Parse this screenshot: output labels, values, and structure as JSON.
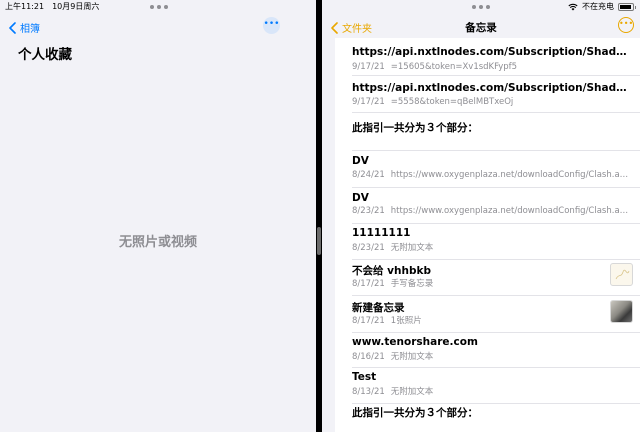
{
  "status": {
    "time": "上午11:21",
    "date": "10月9日周六",
    "charging": "不在充电",
    "battery_level": 0.9
  },
  "left_pane": {
    "back_label": "相簿",
    "more_label": "•••",
    "album_title": "个人收藏",
    "empty_message": "无照片或视频"
  },
  "right_pane": {
    "back_label": "文件夹",
    "title": "备忘录",
    "more_label": "•••",
    "notes": [
      {
        "title": "https://api.nxtlnodes.com/Subscription/ShadowRocket...",
        "date": "9/17/21",
        "preview": "=15605&token=Xv1sdKFypf5"
      },
      {
        "title": "https://api.nxtlnodes.com/Subscription/ShadowRocket...",
        "date": "9/17/21",
        "preview": "=5558&token=qBelMBTxeOj"
      },
      {
        "title": "此指引一共分为３个部分：",
        "date": "",
        "preview": ""
      },
      {
        "title": "DV",
        "date": "8/24/21",
        "preview": "https://www.oxygenplaza.net/downloadConfig/Clash.as..."
      },
      {
        "title": "DV",
        "date": "8/23/21",
        "preview": "https://www.oxygenplaza.net/downloadConfig/Clash.as..."
      },
      {
        "title": "11111111",
        "date": "8/23/21",
        "preview": "无附加文本"
      },
      {
        "title": "不会给 vhhbkb",
        "date": "8/17/21",
        "preview": "手写备忘录"
      },
      {
        "title": "新建备忘录",
        "date": "8/17/21",
        "preview": "1张照片"
      },
      {
        "title": "www.tenorshare.com",
        "date": "8/16/21",
        "preview": "无附加文本"
      },
      {
        "title": "Test",
        "date": "8/13/21",
        "preview": "无附加文本"
      },
      {
        "title": "此指引一共分为３个部分：",
        "date": "",
        "preview": ""
      }
    ]
  }
}
